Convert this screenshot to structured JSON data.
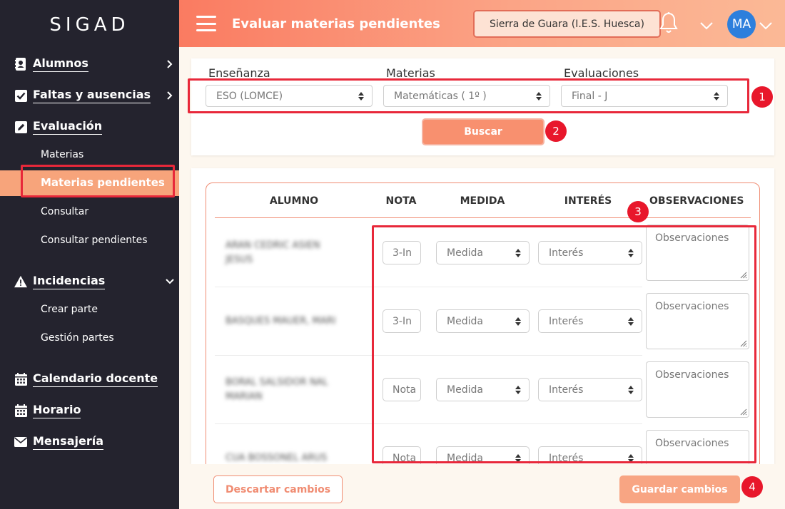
{
  "sidebar": {
    "brand": "SIGAD",
    "items": {
      "alumnos": "Alumnos",
      "faltas": "Faltas y ausencias",
      "evaluacion": "Evaluación",
      "materias": "Materias",
      "materias_pendientes": "Materias pendientes",
      "consultar": "Consultar",
      "consultar_pendientes": "Consultar pendientes",
      "incidencias": "Incidencias",
      "crear_parte": "Crear parte",
      "gestion_partes": "Gestión partes",
      "calendario": "Calendario docente",
      "horario": "Horario",
      "mensajeria": "Mensajería"
    }
  },
  "header": {
    "title": "Evaluar materias pendientes",
    "school": "Sierra de Guara (I.E.S. Huesca)",
    "avatar": "MA"
  },
  "filters": {
    "ensenanza": {
      "label": "Enseñanza",
      "value": "ESO (LOMCE)"
    },
    "materias": {
      "label": "Materias",
      "value": "Matemáticas ( 1º )"
    },
    "evaluaciones": {
      "label": "Evaluaciones",
      "value": "Final - J"
    },
    "search_label": "Buscar"
  },
  "table": {
    "headers": {
      "alumno": "ALUMNO",
      "nota": "NOTA",
      "medida": "MEDIDA",
      "interes": "INTERÉS",
      "observaciones": "OBSERVACIONES"
    },
    "rows": [
      {
        "student_line1": "ARAN CEDRIC ASIEN",
        "student_line2": "JESUS",
        "nota": "3-In",
        "medida": "Medida",
        "interes": "Interés",
        "observaciones": "Observaciones"
      },
      {
        "student_line1": "BASQUES MAUER, MARI",
        "student_line2": "",
        "nota": "3-In",
        "medida": "Medida",
        "interes": "Interés",
        "observaciones": "Observaciones"
      },
      {
        "student_line1": "BORAL SALSIDOR NAL",
        "student_line2": "MARIAN",
        "nota": "Nota",
        "medida": "Medida",
        "interes": "Interés",
        "observaciones": "Observaciones"
      },
      {
        "student_line1": "CUA BOSSONEL ARUS",
        "student_line2": "",
        "nota": "Nota",
        "medida": "Medida",
        "interes": "Interés",
        "observaciones": "Observaciones"
      }
    ]
  },
  "actions": {
    "discard": "Descartar cambios",
    "save": "Guardar cambios"
  },
  "annotations": [
    "1",
    "2",
    "3",
    "4"
  ],
  "colors": {
    "sidebar_bg": "#24232e",
    "accent": "#f8906f",
    "highlight": "#e8283a",
    "badge": "#e8172b",
    "avatar": "#2d7fdc"
  }
}
